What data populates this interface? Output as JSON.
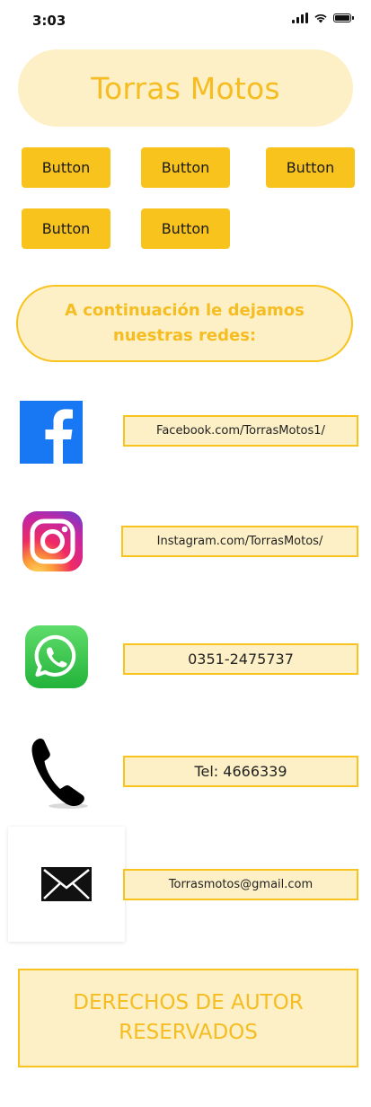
{
  "status_bar": {
    "time": "3:03"
  },
  "header": {
    "title": "Torras Motos"
  },
  "buttons": [
    {
      "label": "Button"
    },
    {
      "label": "Button"
    },
    {
      "label": "Button"
    },
    {
      "label": "Button"
    },
    {
      "label": "Button"
    }
  ],
  "intro": {
    "text": "A continuación le dejamos nuestras redes:"
  },
  "contacts": [
    {
      "icon": "facebook-icon",
      "text": "Facebook.com/TorrasMotos1/"
    },
    {
      "icon": "instagram-icon",
      "text": "Instagram.com/TorrasMotos/"
    },
    {
      "icon": "whatsapp-icon",
      "text": "0351-2475737"
    },
    {
      "icon": "phone-icon",
      "text": "Tel:  4666339"
    },
    {
      "icon": "mail-icon",
      "text": "Torrasmotos@gmail.com"
    }
  ],
  "footer": {
    "text": "DERECHOS DE AUTOR RESERVADOS"
  },
  "colors": {
    "accent": "#f7c31c",
    "accent_light": "#fdf0c6",
    "accent_text": "#f5bd21",
    "facebook": "#1877f2",
    "whatsapp": "#25d366"
  }
}
